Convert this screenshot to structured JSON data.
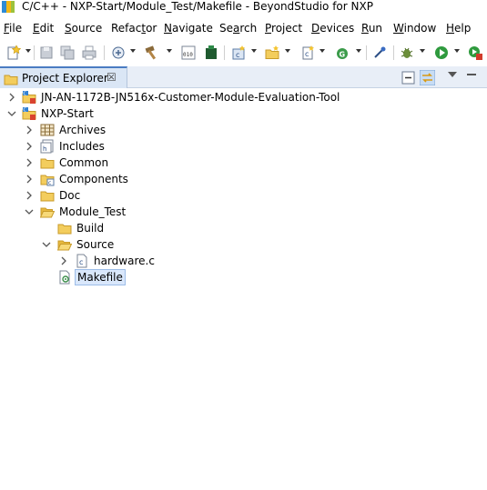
{
  "window": {
    "title": "C/C++ - NXP-Start/Module_Test/Makefile - BeyondStudio for NXP"
  },
  "menu": [
    {
      "pre": "",
      "u": "F",
      "post": "ile"
    },
    {
      "pre": "",
      "u": "E",
      "post": "dit"
    },
    {
      "pre": "",
      "u": "S",
      "post": "ource"
    },
    {
      "pre": "Refac",
      "u": "t",
      "post": "or"
    },
    {
      "pre": "",
      "u": "N",
      "post": "avigate"
    },
    {
      "pre": "Se",
      "u": "a",
      "post": "rch"
    },
    {
      "pre": "",
      "u": "P",
      "post": "roject"
    },
    {
      "pre": "",
      "u": "D",
      "post": "evices"
    },
    {
      "pre": "",
      "u": "R",
      "post": "un"
    },
    {
      "pre": "",
      "u": "W",
      "post": "indow"
    },
    {
      "pre": "",
      "u": "H",
      "post": "elp"
    }
  ],
  "toolbar": {
    "icons": [
      "new-icon",
      "save-icon",
      "save-all-icon",
      "print-icon",
      "debug-config-icon",
      "build-hammer-icon",
      "binary-icon",
      "flash-program-icon",
      "new-cpp-project-icon",
      "new-folder-icon",
      "new-source-file-icon",
      "new-class-icon",
      "pin-icon",
      "debug-icon",
      "run-icon",
      "coverage-icon"
    ]
  },
  "explorer": {
    "tab_label": "Project Explorer",
    "tab_close": "☒"
  },
  "tree": [
    {
      "label": "JN-AN-1172B-JN516x-Customer-Module-Evaluation-Tool",
      "icon": "project-icon",
      "expanded": false
    },
    {
      "label": "NXP-Start",
      "icon": "project-icon",
      "expanded": true
    },
    {
      "label": "Archives",
      "icon": "archives-icon",
      "expanded": false
    },
    {
      "label": "Includes",
      "icon": "includes-icon",
      "expanded": false
    },
    {
      "label": "Common",
      "icon": "folder-icon",
      "expanded": false
    },
    {
      "label": "Components",
      "icon": "source-folder-icon",
      "expanded": false
    },
    {
      "label": "Doc",
      "icon": "folder-icon",
      "expanded": false
    },
    {
      "label": "Module_Test",
      "icon": "folder-open-icon",
      "expanded": true
    },
    {
      "label": "Build",
      "icon": "folder-icon",
      "expanded": false
    },
    {
      "label": "Source",
      "icon": "folder-open-icon",
      "expanded": true
    },
    {
      "label": "hardware.c",
      "icon": "c-file-icon",
      "expanded": false
    },
    {
      "label": "Makefile",
      "icon": "makefile-icon",
      "selected": true
    }
  ]
}
